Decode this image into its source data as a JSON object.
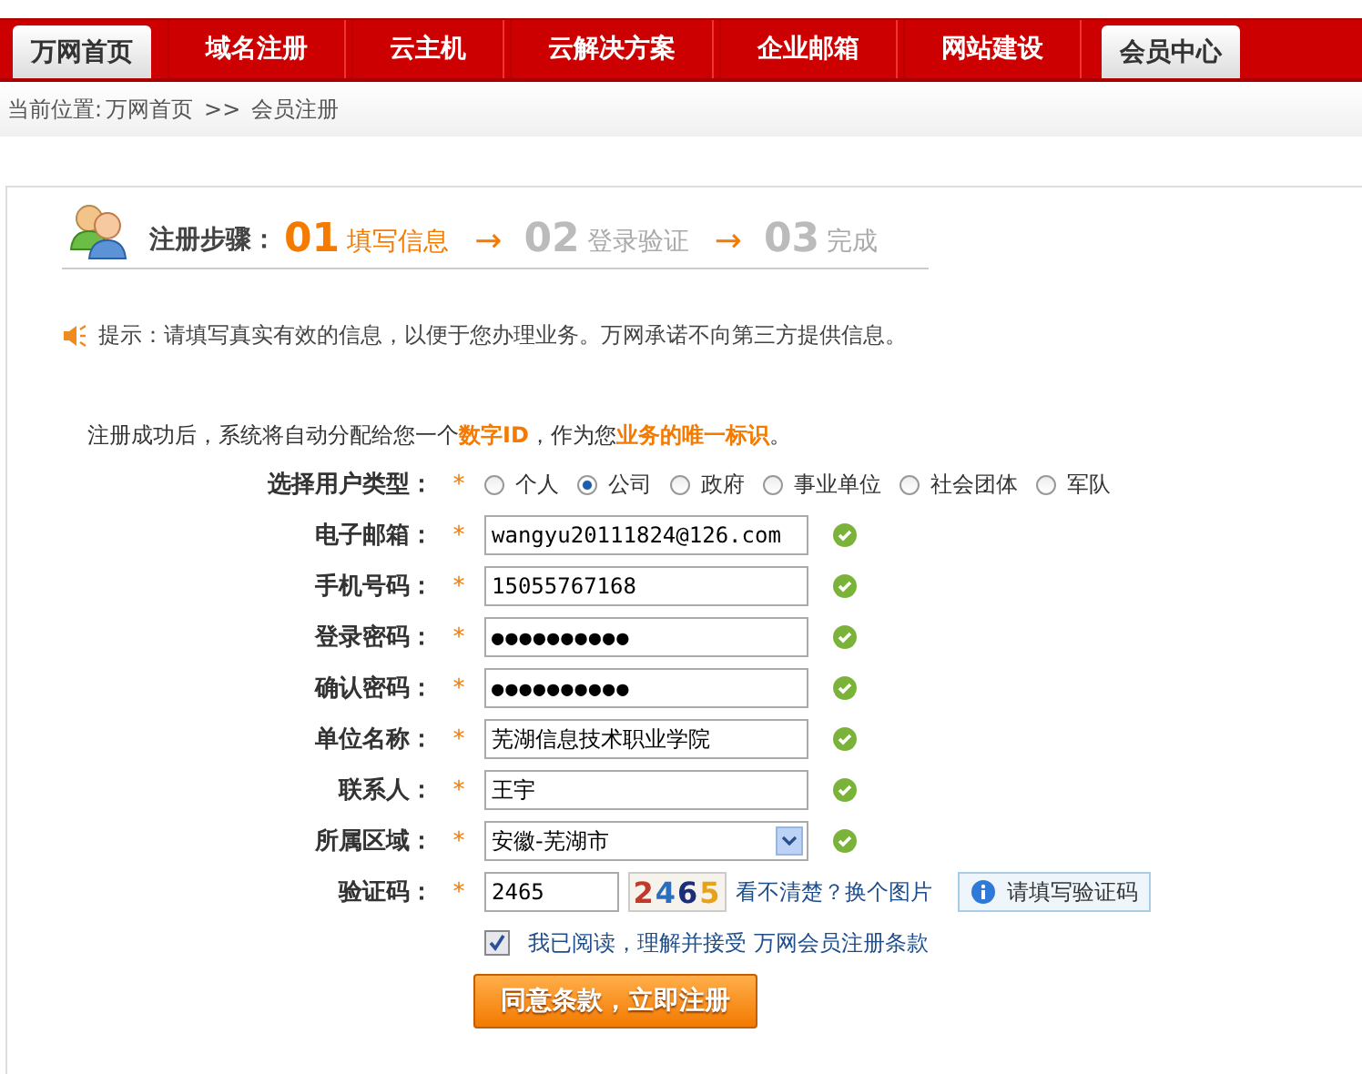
{
  "nav_tabs": [
    {
      "label": "万网首页",
      "selected": true
    },
    {
      "label": "域名注册",
      "selected": false
    },
    {
      "label": "云主机",
      "selected": false
    },
    {
      "label": "云解决方案",
      "selected": false
    },
    {
      "label": "企业邮箱",
      "selected": false
    },
    {
      "label": "网站建设",
      "selected": false
    },
    {
      "label": "会员中心",
      "selected": true
    }
  ],
  "breadcrumb": {
    "prefix": "当前位置:",
    "home": "万网首页",
    "separator": ">>",
    "current": "会员注册"
  },
  "steps": {
    "title": "注册步骤：",
    "items": [
      {
        "number": "01",
        "label": "填写信息",
        "selected": true
      },
      {
        "number": "02",
        "label": "登录验证",
        "selected": false
      },
      {
        "number": "03",
        "label": "完成",
        "selected": false
      }
    ],
    "arrow": "→"
  },
  "tip": "提示：请填写真实有效的信息，以便于您办理业务。万网承诺不向第三方提供信息。",
  "intro": "注册成功后，系统将自动分配给您一个**数字ID**，作为您**业务的唯一标识**。",
  "form": [
    {
      "kind": "radio",
      "label": "选择用户类型：",
      "required_mark": "*",
      "options": [
        {
          "label": "个人",
          "selected": false
        },
        {
          "label": "公司",
          "selected": true
        },
        {
          "label": "政府",
          "selected": false
        },
        {
          "label": "事业单位",
          "selected": false
        },
        {
          "label": "社会团体",
          "selected": false
        },
        {
          "label": "军队",
          "selected": false
        }
      ]
    },
    {
      "kind": "text",
      "label": "电子邮箱：",
      "required_mark": "*",
      "value": "wangyu20111824@126.com",
      "valid": true
    },
    {
      "kind": "text",
      "label": "手机号码：",
      "required_mark": "*",
      "value": "15055767168",
      "valid": true
    },
    {
      "kind": "password",
      "label": "登录密码：",
      "required_mark": "*",
      "value": "●●●●●●●●●●",
      "valid": true
    },
    {
      "kind": "password",
      "label": "确认密码：",
      "required_mark": "*",
      "value": "●●●●●●●●●●",
      "valid": true
    },
    {
      "kind": "text",
      "label": "单位名称：",
      "required_mark": "*",
      "value": "芜湖信息技术职业学院",
      "valid": true
    },
    {
      "kind": "text",
      "label": "联系人：",
      "required_mark": "*",
      "value": "王宇",
      "valid": true
    },
    {
      "kind": "select",
      "label": "所属区域：",
      "required_mark": "*",
      "value": "安徽-芜湖市",
      "valid": true
    },
    {
      "kind": "captcha",
      "label": "验证码：",
      "required_mark": "*",
      "value": "2465",
      "captcha_text": "2465",
      "refresh_link": "看不清楚？换个图片",
      "hint": "请填写验证码"
    }
  ],
  "agreement": {
    "checked": true,
    "text": "我已阅读，理解并接受",
    "link": "万网会员注册条款"
  },
  "submit": "同意条款，立即注册"
}
